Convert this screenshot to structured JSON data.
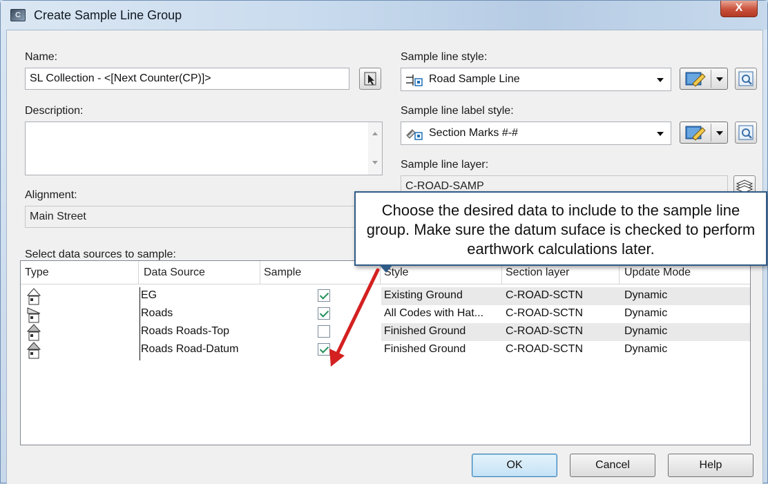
{
  "window": {
    "title": "Create Sample Line Group",
    "close_label": "X"
  },
  "name": {
    "label": "Name:",
    "value": "SL Collection - <[Next Counter(CP)]>"
  },
  "description": {
    "label": "Description:",
    "value": ""
  },
  "alignment": {
    "label": "Alignment:",
    "value": "Main Street"
  },
  "sample_line_style": {
    "label": "Sample line style:",
    "value": "Road Sample Line"
  },
  "sample_line_label_style": {
    "label": "Sample line label style:",
    "value": "Section Marks #-#"
  },
  "sample_line_layer": {
    "label": "Sample line layer:",
    "value": "C-ROAD-SAMP"
  },
  "data_sources": {
    "label": "Select data sources to sample:",
    "columns": [
      "Type",
      "Data Source",
      "Sample",
      "Style",
      "Section layer",
      "Update Mode"
    ],
    "rows": [
      {
        "source": "EG",
        "sample": true,
        "style": "Existing Ground",
        "layer": "C-ROAD-SCTN",
        "mode": "Dynamic"
      },
      {
        "source": "Roads",
        "sample": true,
        "style": "All Codes with Hat...",
        "layer": "C-ROAD-SCTN",
        "mode": "Dynamic"
      },
      {
        "source": "Roads Roads-Top",
        "sample": false,
        "style": "Finished Ground",
        "layer": "C-ROAD-SCTN",
        "mode": "Dynamic"
      },
      {
        "source": "Roads Road-Datum",
        "sample": true,
        "style": "Finished Ground",
        "layer": "C-ROAD-SCTN",
        "mode": "Dynamic"
      }
    ]
  },
  "callout": {
    "text": "Choose the desired data to include to the sample line group. Make sure the datum suface is checked to perform earthwork calculations later."
  },
  "buttons": {
    "ok": "OK",
    "cancel": "Cancel",
    "help": "Help"
  },
  "colors": {
    "accent": "#2f5a86",
    "arrow": "#d42020",
    "check": "#20905a"
  }
}
